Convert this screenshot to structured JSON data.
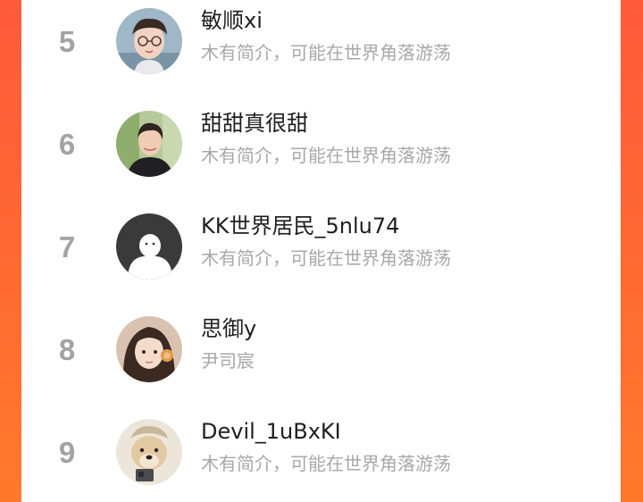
{
  "ranking": {
    "users": [
      {
        "rank": "5",
        "name": "敏顺xi",
        "bio": "木有简介，可能在世界角落游荡",
        "avatar_icon": "avatar-photo-boy-glasses"
      },
      {
        "rank": "6",
        "name": "甜甜真很甜",
        "bio": "木有简介，可能在世界角落游荡",
        "avatar_icon": "avatar-photo-boy-outdoor"
      },
      {
        "rank": "7",
        "name": "KK世界居民_5nlu74",
        "bio": "木有简介，可能在世界角落游荡",
        "avatar_icon": "default-user-icon"
      },
      {
        "rank": "8",
        "name": "思御y",
        "bio": "尹司宸",
        "avatar_icon": "avatar-photo-girl-headphones"
      },
      {
        "rank": "9",
        "name": "Devil_1uBxKI",
        "bio": "木有简介，可能在世界角落游荡",
        "avatar_icon": "avatar-photo-dog"
      }
    ]
  },
  "colors": {
    "background_gradient_top": "#ff5a3c",
    "background_gradient_bottom": "#ff7a2c",
    "rank_text": "#a3a3a3",
    "name_text": "#1e1e1e",
    "bio_text": "#a8a8a8"
  }
}
